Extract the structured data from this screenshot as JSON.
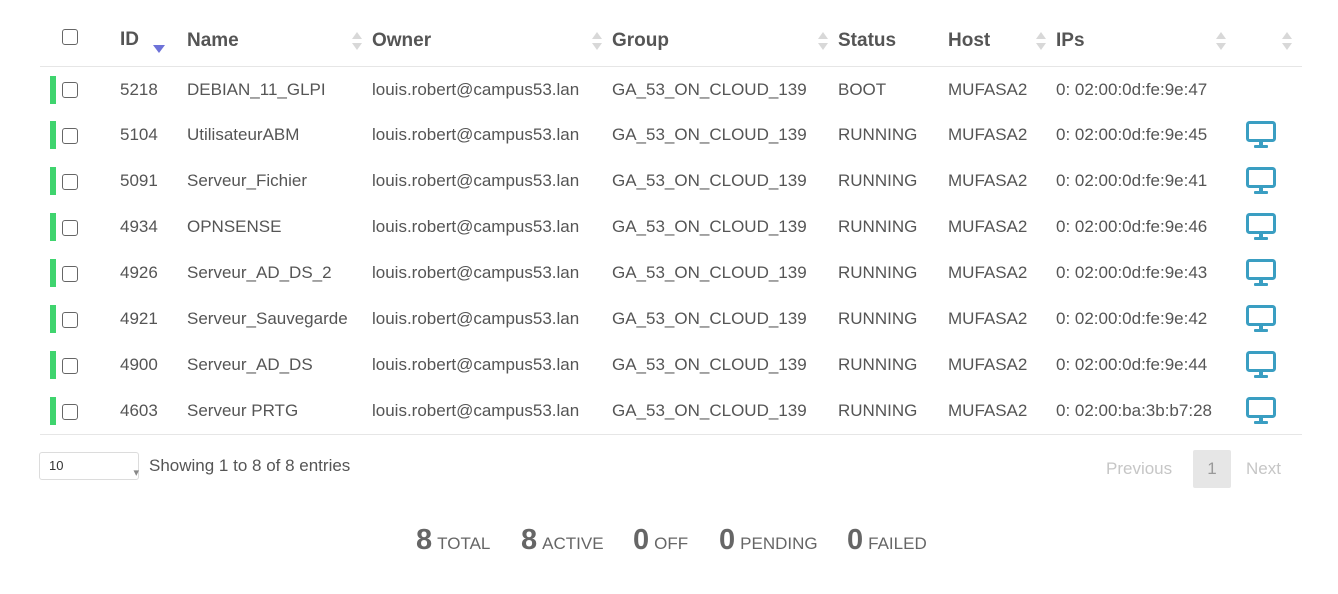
{
  "table": {
    "headers": {
      "id": "ID",
      "name": "Name",
      "owner": "Owner",
      "group": "Group",
      "status": "Status",
      "host": "Host",
      "ips": "IPs"
    },
    "rows": [
      {
        "id": "5218",
        "name": "DEBIAN_11_GLPI",
        "owner": "louis.robert@campus53.lan",
        "group": "GA_53_ON_CLOUD_139",
        "status": "BOOT",
        "host": "MUFASA2",
        "ips": "0: 02:00:0d:fe:9e:47",
        "vnc": false
      },
      {
        "id": "5104",
        "name": "UtilisateurABM",
        "owner": "louis.robert@campus53.lan",
        "group": "GA_53_ON_CLOUD_139",
        "status": "RUNNING",
        "host": "MUFASA2",
        "ips": "0: 02:00:0d:fe:9e:45",
        "vnc": true
      },
      {
        "id": "5091",
        "name": "Serveur_Fichier",
        "owner": "louis.robert@campus53.lan",
        "group": "GA_53_ON_CLOUD_139",
        "status": "RUNNING",
        "host": "MUFASA2",
        "ips": "0: 02:00:0d:fe:9e:41",
        "vnc": true
      },
      {
        "id": "4934",
        "name": "OPNSENSE",
        "owner": "louis.robert@campus53.lan",
        "group": "GA_53_ON_CLOUD_139",
        "status": "RUNNING",
        "host": "MUFASA2",
        "ips": "0: 02:00:0d:fe:9e:46",
        "vnc": true
      },
      {
        "id": "4926",
        "name": "Serveur_AD_DS_2",
        "owner": "louis.robert@campus53.lan",
        "group": "GA_53_ON_CLOUD_139",
        "status": "RUNNING",
        "host": "MUFASA2",
        "ips": "0: 02:00:0d:fe:9e:43",
        "vnc": true
      },
      {
        "id": "4921",
        "name": "Serveur_Sauvegarde",
        "owner": "louis.robert@campus53.lan",
        "group": "GA_53_ON_CLOUD_139",
        "status": "RUNNING",
        "host": "MUFASA2",
        "ips": "0: 02:00:0d:fe:9e:42",
        "vnc": true
      },
      {
        "id": "4900",
        "name": "Serveur_AD_DS",
        "owner": "louis.robert@campus53.lan",
        "group": "GA_53_ON_CLOUD_139",
        "status": "RUNNING",
        "host": "MUFASA2",
        "ips": "0: 02:00:0d:fe:9e:44",
        "vnc": true
      },
      {
        "id": "4603",
        "name": "Serveur PRTG",
        "owner": "louis.robert@campus53.lan",
        "group": "GA_53_ON_CLOUD_139",
        "status": "RUNNING",
        "host": "MUFASA2",
        "ips": "0: 02:00:ba:3b:b7:28",
        "vnc": true
      }
    ],
    "state_color": "#3fd46e",
    "vnc_icon_color": "#3a9ec2"
  },
  "footer": {
    "page_length": "10",
    "info": "Showing 1 to 8 of 8 entries",
    "previous": "Previous",
    "current_page": "1",
    "next": "Next"
  },
  "summary": [
    {
      "value": "8",
      "label": "TOTAL"
    },
    {
      "value": "8",
      "label": "ACTIVE"
    },
    {
      "value": "0",
      "label": "OFF"
    },
    {
      "value": "0",
      "label": "PENDING"
    },
    {
      "value": "0",
      "label": "FAILED"
    }
  ]
}
